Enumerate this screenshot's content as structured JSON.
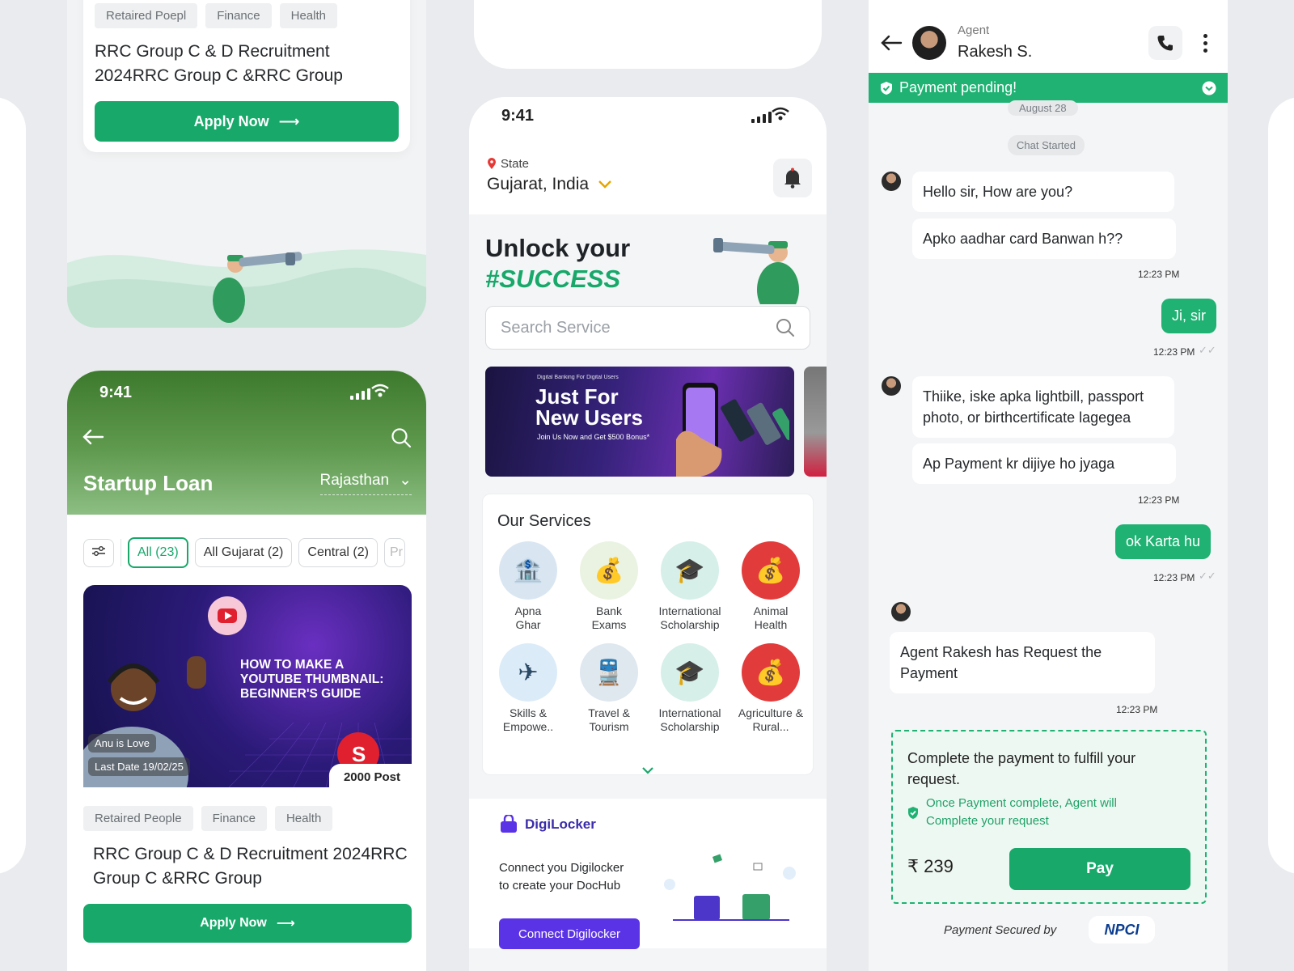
{
  "job_card_top": {
    "tags": [
      "Retaired Poepl",
      "Finance",
      "Health"
    ],
    "title": "RRC Group C & D Recruitment 2024RRC Group C &RRC Group",
    "apply_label": "Apply Now"
  },
  "startup_screen": {
    "time": "9:41",
    "title": "Startup Loan",
    "region": "Rajasthan",
    "filters": [
      "All (23)",
      "All Gujarat (2)",
      "Central (2)",
      "Pr"
    ],
    "thumbnail_text": "HOW TO MAKE A YOUTUBE THUMBNAIL: BEGINNER'S GUIDE",
    "author": "Anu is Love",
    "last_date": "Last Date 19/02/25",
    "post_count": "2000 Post",
    "tags": [
      "Retaired People",
      "Finance",
      "Health"
    ],
    "card_title": "RRC Group C & D Recruitment 2024RRC Group C &RRC Group",
    "apply_label": "Apply Now"
  },
  "home_screen": {
    "time": "9:41",
    "location_label": "State",
    "location_value": "Gujarat, India",
    "hero_line1": "Unlock your",
    "hero_line2": "#SUCCESS",
    "search_placeholder": "Search Service",
    "banner": {
      "tag": "Digital Banking For Digital Users",
      "title_line1": "Just For",
      "title_line2": "New Users",
      "subtitle": "Join Us Now and Get $500 Bonus*"
    },
    "services_title": "Our Services",
    "services": [
      {
        "label": "Apna\nGhar",
        "icon": "bank-building-icon",
        "color": "#d9e6f2"
      },
      {
        "label": "Bank\nExams",
        "icon": "loan-coin-icon",
        "color": "#eaf3e2"
      },
      {
        "label": "International\nScholarship",
        "icon": "globe-graduation-icon",
        "color": "#d6efe9"
      },
      {
        "label": "Animal\nHealth",
        "icon": "money-bag-icon",
        "color": "#e23b3b"
      },
      {
        "label": "Skills &\nEmpowe..",
        "icon": "airplane-globe-icon",
        "color": "#dcebf8"
      },
      {
        "label": "Travel &\nTourism",
        "icon": "train-icon",
        "color": "#dfe7ef"
      },
      {
        "label": "International\nScholarship",
        "icon": "globe-graduation-icon",
        "color": "#d6efe9"
      },
      {
        "label": "Agriculture &\nRural...",
        "icon": "money-bag-icon",
        "color": "#e23b3b"
      }
    ],
    "digilocker_brand": "DigiLocker",
    "digilocker_text_1": "Connect you Digilocker",
    "digilocker_text_2": "to create your DocHub",
    "digilocker_button": "Connect Digilocker"
  },
  "chat_screen": {
    "role": "Agent",
    "name": "Rakesh S.",
    "banner": "Payment pending!",
    "date_pill": "August 28",
    "chat_started": "Chat Started",
    "messages": [
      {
        "from": "agent",
        "text": "Hello sir, How are you?"
      },
      {
        "from": "agent",
        "text": "Apko aadhar card Banwan h??"
      },
      {
        "from": "system",
        "time": "12:23 PM"
      },
      {
        "from": "user",
        "text": "Ji, sir",
        "time": "12:23 PM"
      },
      {
        "from": "agent",
        "text": "Thiike, iske apka lightbill, passport photo, or birthcertificate lagegea"
      },
      {
        "from": "agent",
        "text": "Ap Payment kr dijiye ho jyaga"
      },
      {
        "from": "system",
        "time": "12:23 PM"
      },
      {
        "from": "user",
        "text": "ok Karta hu",
        "time": "12:23 PM"
      },
      {
        "from": "agent",
        "text": "Agent Rakesh has Request the Payment"
      },
      {
        "from": "system",
        "time": "12:23 PM"
      }
    ],
    "payment": {
      "heading": "Complete the payment to fulfill your request.",
      "note": "Once Payment complete, Agent will Complete your request",
      "amount": "₹ 239",
      "pay_label": "Pay"
    },
    "secured_by": "Payment Secured by",
    "secured_brand": "NPCI"
  },
  "colors": {
    "accent_green": "#17a86a",
    "chat_green": "#1fb273",
    "digilocker_purple": "#5b33e6"
  }
}
